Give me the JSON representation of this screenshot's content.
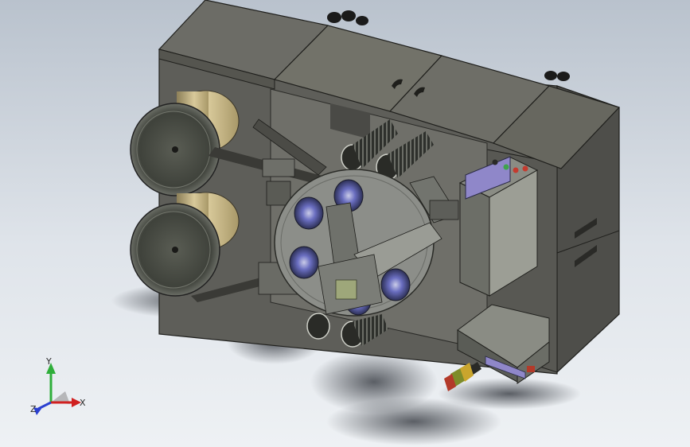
{
  "viewport": {
    "background_top": "#b9c2cd",
    "background_bottom": "#eef1f4"
  },
  "model": {
    "body_color": "#5d5d58",
    "panel_color": "#6a6a64",
    "spool_color": "#c9b98a",
    "disc_color": "#4d5047",
    "turret_color": "#8b8d88",
    "hub_accent": "#5b5fb0",
    "screen_color": "#8f87c9",
    "indicator_colors": [
      "#3fa34d",
      "#c43b2f",
      "#c43b2f"
    ],
    "tower_light_colors": [
      "#7d8c2a",
      "#c9a52d",
      "#b33a2a"
    ]
  },
  "triad": {
    "x_label": "X",
    "y_label": "Y",
    "z_label": "Z",
    "x_color": "#d02020",
    "y_color": "#2fae3a",
    "z_color": "#2a3fd0"
  }
}
